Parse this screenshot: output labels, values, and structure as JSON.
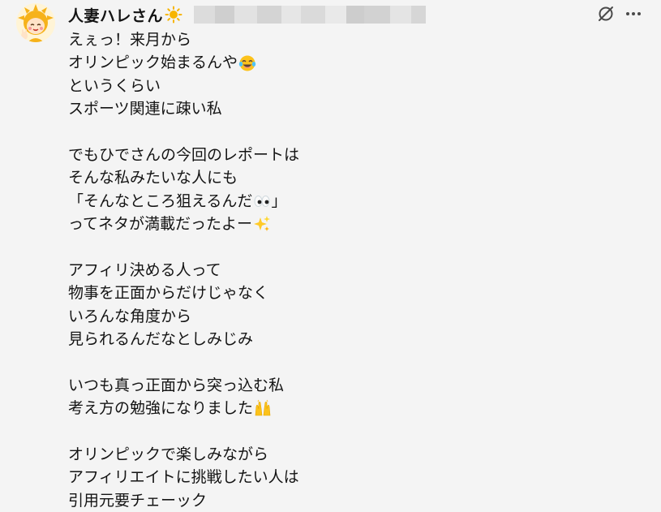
{
  "author": {
    "display_name": "人妻ハレさん",
    "name_emoji": "sun-emoji",
    "handle_redacted": true
  },
  "actions": {
    "mute_icon": "eye-slash-icon",
    "more_icon": "more-dots-icon"
  },
  "post": {
    "lines": [
      "えぇっ！来月から",
      "オリンピック始まるんや",
      "というくらい",
      "スポーツ関連に疎い私",
      "",
      "でもひでさんの今回のレポートは",
      "そんな私みたいな人にも",
      "「そんなところ狙えるんだ",
      "ってネタが満載だったよー",
      "",
      "アフィリ決める人って",
      "物事を正面からだけじゃなく",
      "いろんな角度から",
      "見られるんだなとしみじみ",
      "",
      "いつも真っ正面から突っ込む私",
      "考え方の勉強になりました",
      "",
      "オリンピックで楽しみながら",
      "アフィリエイトに挑戦したい人は",
      "引用元要チェーック"
    ],
    "line_suffix_text": {
      "7": "」"
    },
    "line_emojis": {
      "1": "joy-tears-emoji",
      "7": "eyes-emoji",
      "8": "sparkles-emoji",
      "16": "raised-hands-emoji"
    }
  },
  "colors": {
    "background": "#f4f4f4",
    "text": "#141414",
    "icon": "#4a4a4a",
    "sun": "#f7b500"
  }
}
